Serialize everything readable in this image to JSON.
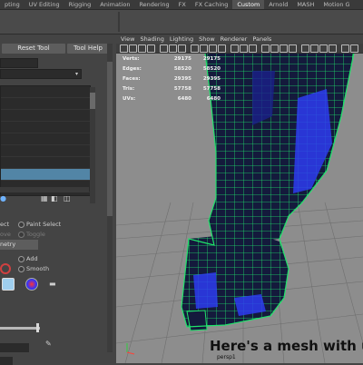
{
  "shelf": {
    "tabs": [
      {
        "label": "pting",
        "active": false
      },
      {
        "label": "UV Editing",
        "active": false
      },
      {
        "label": "Rigging",
        "active": false
      },
      {
        "label": "Animation",
        "active": false
      },
      {
        "label": "Rendering",
        "active": false
      },
      {
        "label": "FX",
        "active": false
      },
      {
        "label": "FX Caching",
        "active": false
      },
      {
        "label": "Custom",
        "active": true
      },
      {
        "label": "Arnold",
        "active": false
      },
      {
        "label": "MASH",
        "active": false
      },
      {
        "label": "Motion G",
        "active": false
      }
    ]
  },
  "tool_settings": {
    "reset_tool_label": "Reset Tool",
    "tool_help_label": "Tool Help",
    "select_label": "ect",
    "paint_select_label": "Paint Select",
    "move_label": "ove",
    "toggle_label": "Toggle",
    "geometry_label": "netry",
    "add_label": "Add",
    "smooth_label": "Smooth"
  },
  "viewport": {
    "menu": [
      "View",
      "Shading",
      "Lighting",
      "Show",
      "Renderer",
      "Panels"
    ],
    "hud": [
      {
        "label": "Verts:",
        "v1": "29175",
        "v2": "29175"
      },
      {
        "label": "Edges:",
        "v1": "58520",
        "v2": "58520"
      },
      {
        "label": "Faces:",
        "v1": "29395",
        "v2": "29395"
      },
      {
        "label": "Tris:",
        "v1": "57758",
        "v2": "57758"
      },
      {
        "label": "UVs:",
        "v1": "6480",
        "v2": "6480"
      }
    ],
    "camera_label": "persp1",
    "caption": "Here's a mesh with u"
  },
  "colors": {
    "mesh_wire": "#1fe36a",
    "mesh_fill": "#1a1f8a",
    "mesh_highlight": "#2d3cf0",
    "selection_row": "#5285a6",
    "grid_bg": "#8d8d8d"
  },
  "icons": [
    "shelf-tool-icon",
    "grid-icon",
    "camera-icon",
    "wireframe-icon",
    "paint-icon",
    "folder-icon",
    "color-swatch-icon",
    "pen-icon"
  ]
}
